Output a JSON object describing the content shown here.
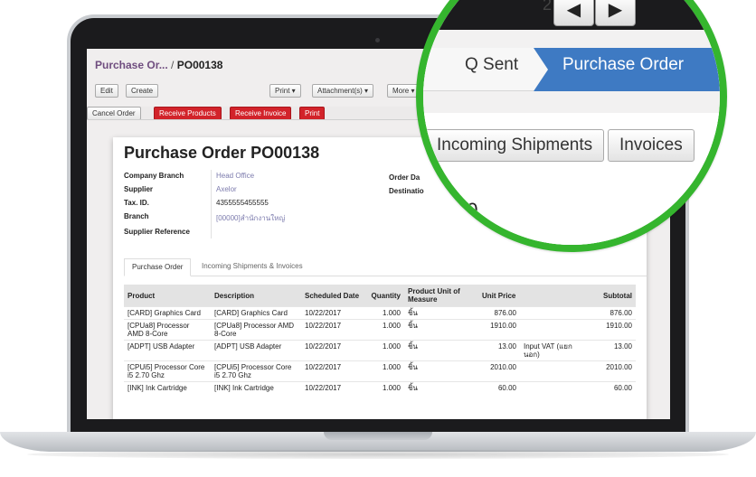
{
  "breadcrumb": {
    "parent": "Purchase Or...",
    "separator": " / ",
    "current": "PO00138"
  },
  "toolbar": {
    "edit": "Edit",
    "create": "Create",
    "print": "Print ▾",
    "attachments": "Attachment(s) ▾",
    "more": "More ▾"
  },
  "actions": {
    "cancel_order": "Cancel Order",
    "receive_products": "Receive Products",
    "receive_invoice": "Receive Invoice",
    "print": "Print"
  },
  "colors": {
    "accent_red": "#d2232a",
    "status_active": "#3e7ac3",
    "lens_ring": "#35b52e",
    "link_purple": "#6f4d7f"
  },
  "sheet": {
    "title": "Purchase Order PO00138",
    "fields": [
      {
        "label": "Company Branch",
        "value": "Head Office"
      },
      {
        "label": "Supplier",
        "value": "Axelor"
      },
      {
        "label": "Tax. ID.",
        "value": "4355555455555"
      },
      {
        "label": "Branch",
        "value": "[00000]สำนักงานใหญ่"
      },
      {
        "label": "Supplier Reference",
        "value": ""
      }
    ],
    "right_fields": [
      {
        "label": "Order Da"
      },
      {
        "label": "Destinatio"
      }
    ]
  },
  "tabs": [
    {
      "label": "Purchase Order"
    },
    {
      "label": "Incoming Shipments & Invoices"
    }
  ],
  "lines": {
    "headers": [
      "Product",
      "Description",
      "Scheduled Date",
      "Quantity",
      "Product Unit of Measure",
      "Unit Price",
      "",
      "Subtotal"
    ],
    "rows": [
      {
        "product": "[CARD] Graphics Card",
        "description": "[CARD] Graphics Card",
        "date": "10/22/2017",
        "qty": "1.000",
        "uom": "ชิ้น",
        "price": "876.00",
        "taxes": "",
        "subtotal": "876.00"
      },
      {
        "product": "[CPUa8] Processor AMD 8-Core",
        "description": "[CPUa8] Processor AMD 8-Core",
        "date": "10/22/2017",
        "qty": "1.000",
        "uom": "ชิ้น",
        "price": "1910.00",
        "taxes": "",
        "subtotal": "1910.00"
      },
      {
        "product": "[ADPT] USB Adapter",
        "description": "[ADPT] USB Adapter",
        "date": "10/22/2017",
        "qty": "1.000",
        "uom": "ชิ้น",
        "price": "13.00",
        "taxes": "Input VAT (แยกนอก)",
        "subtotal": "13.00"
      },
      {
        "product": "[CPUi5] Processor Core i5 2.70 Ghz",
        "description": "[CPUi5] Processor Core i5 2.70 Ghz",
        "date": "10/22/2017",
        "qty": "1.000",
        "uom": "ชิ้น",
        "price": "2010.00",
        "taxes": "",
        "subtotal": "2010.00"
      },
      {
        "product": "[INK] Ink Cartridge",
        "description": "[INK] Ink Cartridge",
        "date": "10/22/2017",
        "qty": "1.000",
        "uom": "ชิ้น",
        "price": "60.00",
        "taxes": "",
        "subtotal": "60.00"
      }
    ]
  },
  "lens": {
    "pager_text": "2",
    "prev_icon": "arrow-left-icon",
    "next_icon": "arrow-right-icon",
    "prev_glyph": "◀",
    "next_glyph": "▶",
    "status_prev": "Q Sent",
    "status_active": "Purchase Order",
    "btn_shipments": "Incoming Shipments",
    "btn_invoices": "Invoices",
    "date_fragment": "20"
  }
}
